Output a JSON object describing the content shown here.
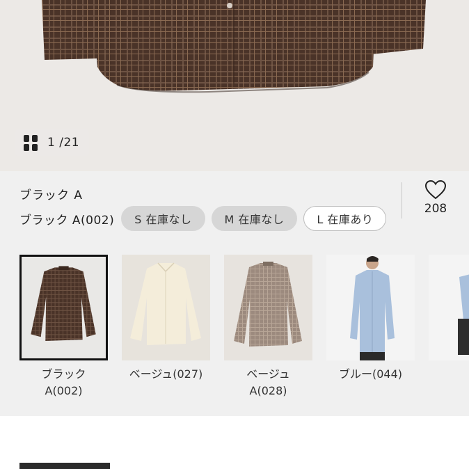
{
  "gallery": {
    "counter_current": "1",
    "counter_total": "/21",
    "grid_icon": "grid-view-icon"
  },
  "product": {
    "selected_color_name": "ブラック A",
    "size_row_color_label": "ブラック A(002)",
    "sizes": [
      {
        "label": "S 在庫なし",
        "stock": "out"
      },
      {
        "label": "M 在庫なし",
        "stock": "out"
      },
      {
        "label": "L 在庫あり",
        "stock": "in"
      }
    ],
    "favorite_count": "208",
    "favorite_icon": "heart-icon"
  },
  "variants": [
    {
      "label": "ブラック\nA(002)",
      "selected": true
    },
    {
      "label": "ベージュ(027)",
      "selected": false
    },
    {
      "label": "ベージュ\nA(028)",
      "selected": false
    },
    {
      "label": "ブルー(044)",
      "selected": false
    },
    {
      "label": "",
      "selected": false
    }
  ],
  "colors": {
    "shirt_brown": "#4a3328",
    "shirt_cream": "#f1ead5",
    "shirt_taupe": "#9c8a7e",
    "shirt_blue": "#a9c0dc",
    "panel_bg": "#f0f0f0"
  }
}
